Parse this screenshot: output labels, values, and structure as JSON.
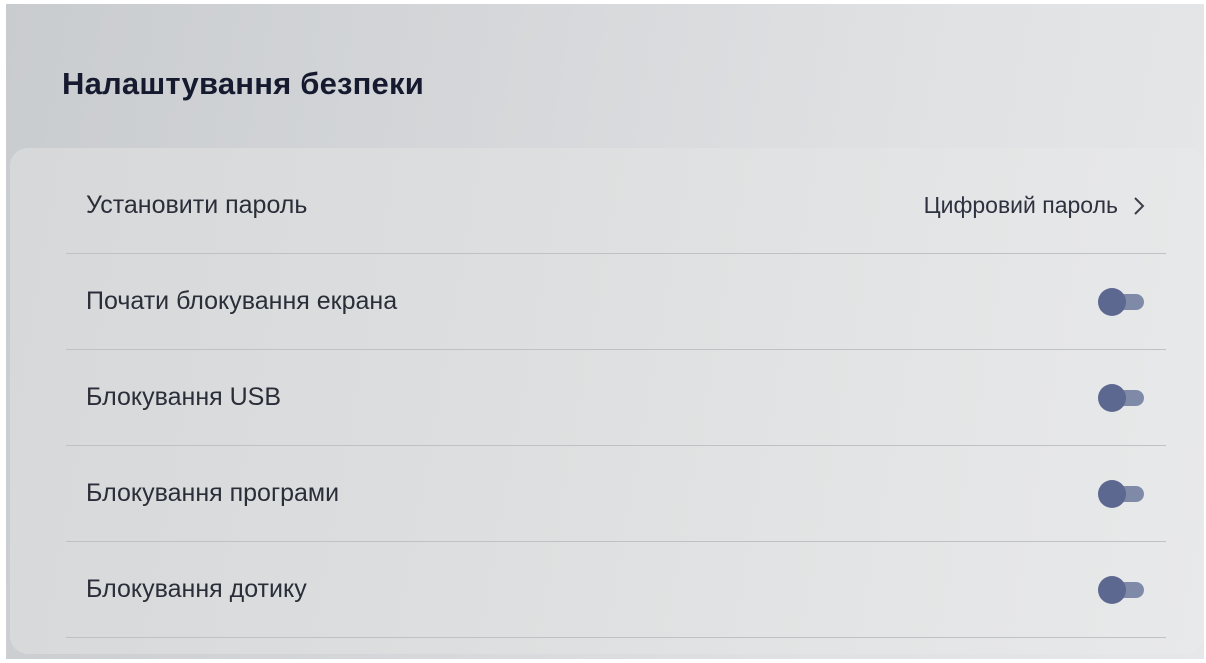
{
  "page": {
    "title": "Налаштування безпеки"
  },
  "settings": {
    "items": [
      {
        "label": "Установити пароль",
        "value": "Цифровий пароль",
        "type": "link",
        "icon": "chevron-right-icon"
      },
      {
        "label": "Почати блокування екрана",
        "type": "toggle",
        "state": "off"
      },
      {
        "label": "Блокування USB",
        "type": "toggle",
        "state": "off"
      },
      {
        "label": "Блокування програми",
        "type": "toggle",
        "state": "off"
      },
      {
        "label": "Блокування дотику",
        "type": "toggle",
        "state": "off"
      }
    ]
  },
  "colors": {
    "title": "#151a2e",
    "toggle_knob": "#5c6890",
    "toggle_track": "#7f8aa8"
  }
}
